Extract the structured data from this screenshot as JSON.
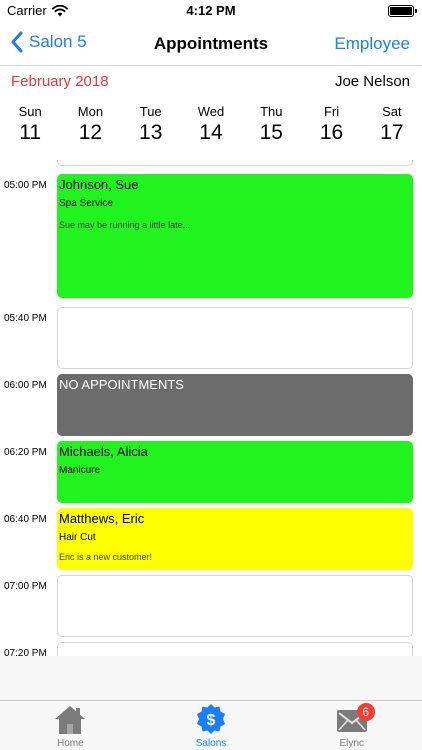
{
  "status": {
    "carrier": "Carrier",
    "time": "4:12 PM"
  },
  "nav": {
    "back_label": "Salon 5",
    "title": "Appointments",
    "right_label": "Employee"
  },
  "header": {
    "month": "February 2018",
    "employee": "Joe Nelson"
  },
  "week": {
    "days": [
      {
        "name": "Sun",
        "number": "11"
      },
      {
        "name": "Mon",
        "number": "12"
      },
      {
        "name": "Tue",
        "number": "13"
      },
      {
        "name": "Wed",
        "number": "14"
      },
      {
        "name": "Thu",
        "number": "15"
      },
      {
        "name": "Fri",
        "number": "16"
      },
      {
        "name": "Sat",
        "number": "17"
      }
    ],
    "selected_index": 5
  },
  "schedule": {
    "slots": [
      {
        "time": "05:00 PM",
        "client": "Johnson, Sue",
        "service": "Spa Service",
        "note": "Sue may be running a little late...",
        "color": "#20f31d"
      },
      {
        "time": "05:40 PM",
        "client": "",
        "service": "",
        "note": "",
        "color": "#ffffff"
      },
      {
        "time": "06:00 PM",
        "client": "NO APPOINTMENTS",
        "service": "",
        "note": "",
        "color": "#6c6c6c"
      },
      {
        "time": "06:20 PM",
        "client": "Michaels, Alicia",
        "service": "Manicure",
        "note": "",
        "color": "#20f31d"
      },
      {
        "time": "06:40 PM",
        "client": "Matthews, Eric",
        "service": "Hair Cut",
        "note": "Eric is a new customer!",
        "color": "#fdfe00"
      },
      {
        "time": "07:00 PM",
        "client": "",
        "service": "",
        "note": "",
        "color": "#ffffff"
      },
      {
        "time": "07:20 PM",
        "client": "",
        "service": "",
        "note": "",
        "color": "#ffffff"
      }
    ]
  },
  "tabs": [
    {
      "label": "Home",
      "icon": "house-icon",
      "active": false
    },
    {
      "label": "Salons",
      "icon": "dollar-badge-icon",
      "active": true
    },
    {
      "label": "Elync",
      "icon": "envelope-icon",
      "active": false,
      "badge": "6"
    }
  ],
  "colors": {
    "accent": "#1a7ef7",
    "today": "#e5373a",
    "badge": "#ff3b30"
  }
}
